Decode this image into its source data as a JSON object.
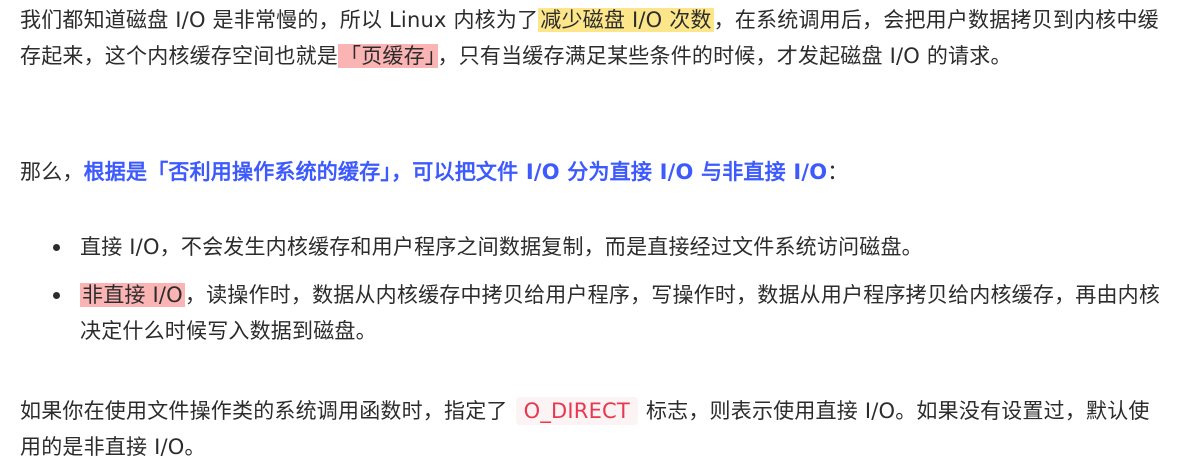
{
  "para1": {
    "t1": "我们都知道磁盘 I/O 是非常慢的，所以 Linux 内核为了",
    "hl1": "减少磁盘 I/O 次数",
    "t2": "，在系统调用后，会把用户数据拷贝到内核中缓存起来，这个内核缓存空间也就是",
    "hl2": "「页缓存」",
    "t3": "，只有当缓存满足某些条件的时候，才发起磁盘 I/O 的请求。"
  },
  "para2": {
    "t1": "那么，",
    "bold": "根据是「否利用操作系统的缓存」，可以把文件 I/O 分为直接 I/O 与非直接 I/O",
    "t2": "："
  },
  "list": {
    "item1": {
      "text": "直接 I/O，不会发生内核缓存和用户程序之间数据复制，而是直接经过文件系统访问磁盘。"
    },
    "item2": {
      "hl": "非直接 I/O",
      "text": "，读操作时，数据从内核缓存中拷贝给用户程序，写操作时，数据从用户程序拷贝给内核缓存，再由内核决定什么时候写入数据到磁盘。"
    }
  },
  "para3": {
    "t1": "如果你在使用文件操作类的系统调用函数时，指定了",
    "code": "O_DIRECT",
    "t2": "标志，则表示使用直接 I/O。如果没有设置过，默认使用的是非直接 I/O。"
  }
}
